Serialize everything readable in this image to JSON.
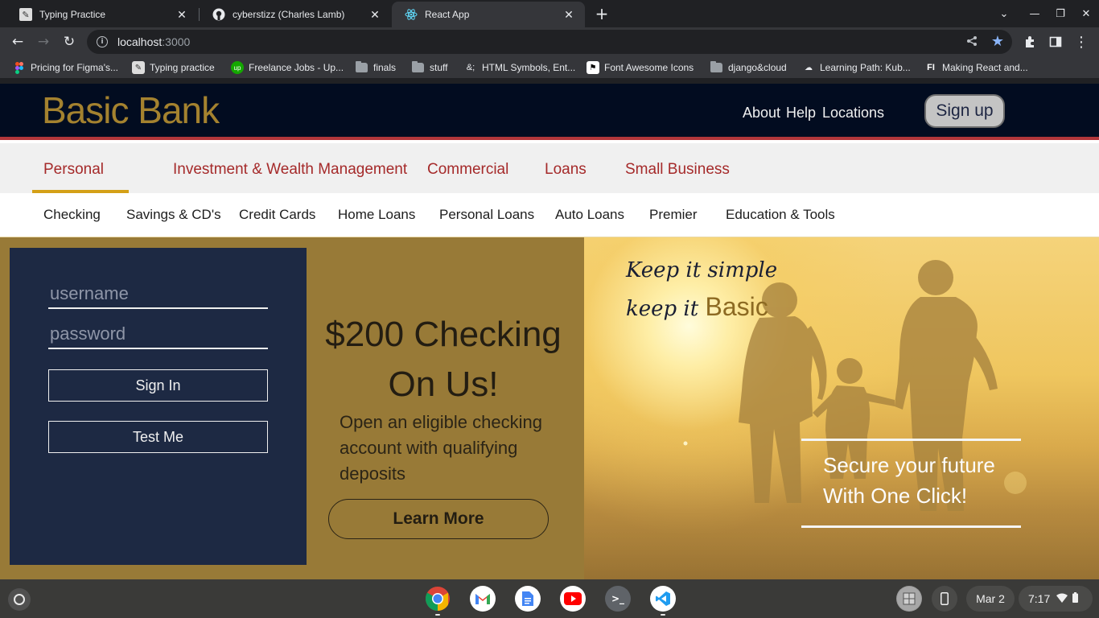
{
  "browser": {
    "tabs": [
      {
        "title": "Typing Practice",
        "favicon": "typing-icon"
      },
      {
        "title": "cyberstizz (Charles Lamb)",
        "favicon": "github-icon"
      },
      {
        "title": "React App",
        "favicon": "react-icon"
      }
    ],
    "active_tab": 2,
    "url_host": "localhost",
    "url_port": ":3000",
    "bookmarks": [
      "Pricing for Figma's...",
      "Typing practice",
      "Freelance Jobs - Up...",
      "finals",
      "stuff",
      "HTML Symbols, Ent...",
      "Font Awesome Icons",
      "django&cloud",
      "Learning Path: Kub...",
      "Making React and..."
    ]
  },
  "site": {
    "logo": "Basic Bank",
    "topnav": [
      "About",
      "Help",
      "Locations"
    ],
    "signup": "Sign up",
    "categories": [
      "Personal",
      "Investment & Wealth Management",
      "Commercial",
      "Loans",
      "Small Business"
    ],
    "active_category": "Personal",
    "subnav": [
      "Checking",
      "Savings & CD's",
      "Credit Cards",
      "Home Loans",
      "Personal Loans",
      "Auto Loans",
      "Premier",
      "Education & Tools"
    ],
    "login": {
      "username_placeholder": "username",
      "password_placeholder": "password",
      "signin": "Sign In",
      "testme": "Test Me"
    },
    "promo": {
      "title_line1": "$200 Checking",
      "title_line2": "On Us!",
      "description": "Open an eligible checking account with qualifying deposits",
      "button": "Learn More"
    },
    "hero": {
      "tag_line1": "Keep it simple",
      "tag_line2": "keep it ",
      "tag_basic": "Basic",
      "secure_line1": "Secure your future",
      "secure_line2": "With One Click!"
    }
  },
  "shelf": {
    "apps": [
      "chrome-icon",
      "gmail-icon",
      "docs-icon",
      "youtube-icon",
      "terminal-icon",
      "vscode-icon"
    ],
    "date": "Mar 2",
    "time": "7:17"
  },
  "colors": {
    "header_bg": "#020c20",
    "logo_gold": "#a4822f",
    "nav_red": "#a52a2a",
    "active_underline": "#d4a017",
    "login_panel": "#1d2943",
    "promo_bg": "#987a37"
  }
}
